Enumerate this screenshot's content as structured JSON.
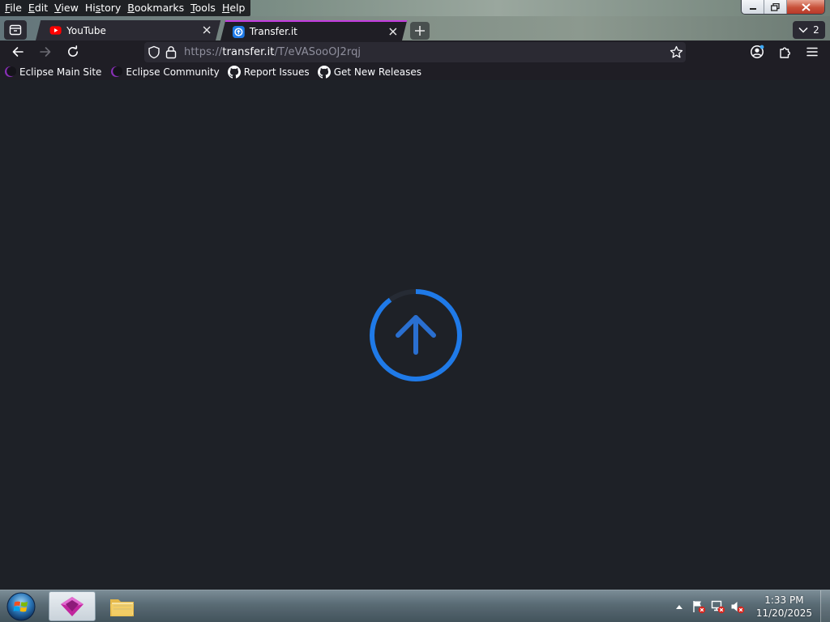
{
  "menu": {
    "items": [
      {
        "key": "F",
        "rest": "ile"
      },
      {
        "key": "E",
        "rest": "dit"
      },
      {
        "key": "V",
        "rest": "iew"
      },
      {
        "pre": "Hi",
        "key": "s",
        "rest": "tory"
      },
      {
        "key": "B",
        "rest": "ookmarks"
      },
      {
        "key": "T",
        "rest": "ools"
      },
      {
        "key": "H",
        "rest": "elp"
      }
    ]
  },
  "window_controls": {
    "minimize": "minimize-icon",
    "restore": "restore-icon",
    "close": "close-icon"
  },
  "tabs": [
    {
      "title": "YouTube",
      "favicon": "youtube-icon",
      "active": false
    },
    {
      "title": "Transfer.it",
      "favicon": "transfer-it-icon",
      "active": true
    }
  ],
  "tab_count": "2",
  "toolbar": {
    "url": {
      "scheme": "https://",
      "host": "transfer.it",
      "path": "/T/eVASooOJ2rqj"
    },
    "back_enabled": true,
    "forward_enabled": false
  },
  "bookmarks": [
    {
      "label": "Eclipse Main Site",
      "icon": "eclipse-icon"
    },
    {
      "label": "Eclipse Community",
      "icon": "eclipse-icon"
    },
    {
      "label": "Report Issues",
      "icon": "github-icon"
    },
    {
      "label": "Get New Releases",
      "icon": "github-icon"
    }
  ],
  "content": {
    "indicator": "upload-progress-ring",
    "progress_fraction": 0.9,
    "accent_color": "#1f7ae8",
    "background_color": "#1e2127"
  },
  "taskbar": {
    "apps": [
      "browser-app-icon",
      "file-explorer-icon"
    ],
    "tray_icons": [
      "action-center-warning-icon",
      "network-disconnected-icon",
      "volume-muted-icon"
    ],
    "clock": {
      "time": "1:33 PM",
      "date": "11/20/2025"
    }
  }
}
